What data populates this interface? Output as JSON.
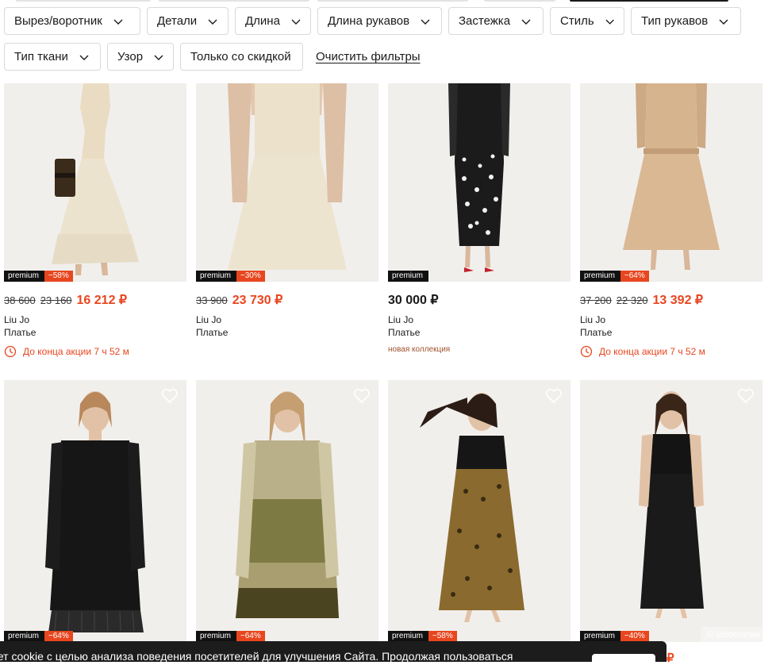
{
  "filters": [
    {
      "label": "Вырез/воротник"
    },
    {
      "label": "Детали"
    },
    {
      "label": "Длина"
    },
    {
      "label": "Длина рукавов"
    },
    {
      "label": "Застежка"
    },
    {
      "label": "Стиль"
    },
    {
      "label": "Тип рукавов"
    },
    {
      "label": "Тип ткани"
    },
    {
      "label": "Узор"
    },
    {
      "label": "Только со скидкой"
    }
  ],
  "clear_filters": "Очистить фильтры",
  "products": [
    {
      "badge": "premium",
      "discount": "−58%",
      "old1": "38 600",
      "old2": "23 160",
      "price": "16 212 ₽",
      "brand": "Liu Jo",
      "type": "Платье",
      "promo": "До конца акции 7 ч 52 м"
    },
    {
      "badge": "premium",
      "discount": "−30%",
      "old1": "33 900",
      "price": "23 730 ₽",
      "brand": "Liu Jo",
      "type": "Платье"
    },
    {
      "badge": "premium",
      "price": "30 000 ₽",
      "brand": "Liu Jo",
      "type": "Платье",
      "note": "новая коллекция"
    },
    {
      "badge": "premium",
      "discount": "−64%",
      "old1": "37 200",
      "old2": "22 320",
      "price": "13 392 ₽",
      "brand": "Liu Jo",
      "type": "Платье",
      "promo": "До конца акции 7 ч 52 м"
    },
    {
      "badge": "premium",
      "discount": "−64%"
    },
    {
      "badge": "premium",
      "discount": "−64%"
    },
    {
      "badge": "premium",
      "discount": "−58%"
    },
    {
      "badge": "premium",
      "discount": "−40%"
    }
  ],
  "watermark": "© Шопоголик",
  "cookie_banner": {
    "text": "ует cookie с целью анализа поведения посетителей для улучшения Сайта. Продолжая пользоваться"
  },
  "price_peek": "₽",
  "colors": {
    "accent": "#e8461f",
    "premium_badge": "#111111",
    "cookie_bg": "#1c1c1c"
  }
}
